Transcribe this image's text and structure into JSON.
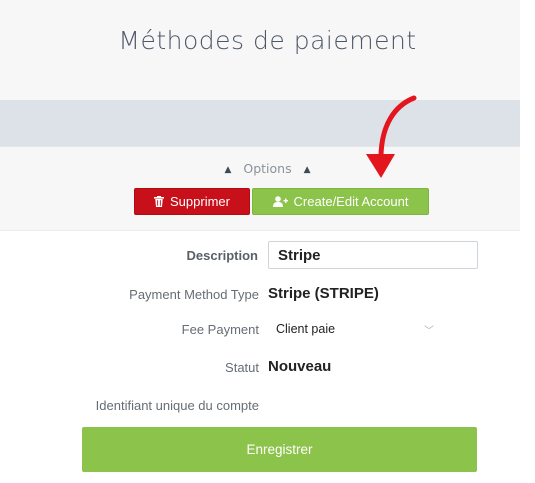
{
  "page": {
    "title": "Méthodes de paiement"
  },
  "options": {
    "label": "Options"
  },
  "actions": {
    "delete_label": "Supprimer",
    "account_label": "Create/Edit Account"
  },
  "form": {
    "description": {
      "label": "Description",
      "value": "Stripe"
    },
    "method_type": {
      "label": "Payment Method Type",
      "value": "Stripe (STRIPE)"
    },
    "fee_payment": {
      "label": "Fee Payment",
      "value": "Client paie"
    },
    "status": {
      "label": "Statut",
      "value": "Nouveau"
    },
    "account_id": {
      "label": "Identifiant unique du compte"
    },
    "save_label": "Enregistrer"
  },
  "icons": {
    "delete": "trash-icon",
    "account": "add-user-icon",
    "annotation": "red-arrow"
  },
  "colors": {
    "danger": "#c8101a",
    "success": "#8cc34b",
    "arrow": "#e3151d",
    "header_bar": "#dde2e9"
  }
}
